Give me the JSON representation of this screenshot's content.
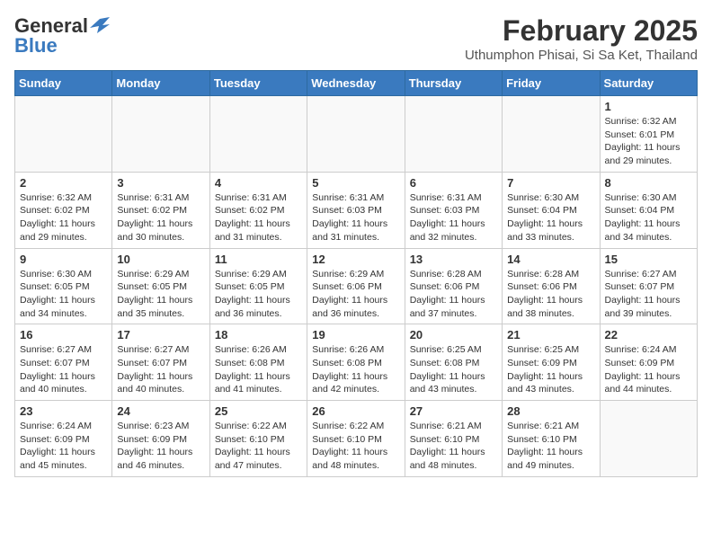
{
  "header": {
    "logo_general": "General",
    "logo_blue": "Blue",
    "month_year": "February 2025",
    "location": "Uthumphon Phisai, Si Sa Ket, Thailand"
  },
  "days_of_week": [
    "Sunday",
    "Monday",
    "Tuesday",
    "Wednesday",
    "Thursday",
    "Friday",
    "Saturday"
  ],
  "weeks": [
    [
      {
        "day": "",
        "info": ""
      },
      {
        "day": "",
        "info": ""
      },
      {
        "day": "",
        "info": ""
      },
      {
        "day": "",
        "info": ""
      },
      {
        "day": "",
        "info": ""
      },
      {
        "day": "",
        "info": ""
      },
      {
        "day": "1",
        "info": "Sunrise: 6:32 AM\nSunset: 6:01 PM\nDaylight: 11 hours and 29 minutes."
      }
    ],
    [
      {
        "day": "2",
        "info": "Sunrise: 6:32 AM\nSunset: 6:02 PM\nDaylight: 11 hours and 29 minutes."
      },
      {
        "day": "3",
        "info": "Sunrise: 6:31 AM\nSunset: 6:02 PM\nDaylight: 11 hours and 30 minutes."
      },
      {
        "day": "4",
        "info": "Sunrise: 6:31 AM\nSunset: 6:02 PM\nDaylight: 11 hours and 31 minutes."
      },
      {
        "day": "5",
        "info": "Sunrise: 6:31 AM\nSunset: 6:03 PM\nDaylight: 11 hours and 31 minutes."
      },
      {
        "day": "6",
        "info": "Sunrise: 6:31 AM\nSunset: 6:03 PM\nDaylight: 11 hours and 32 minutes."
      },
      {
        "day": "7",
        "info": "Sunrise: 6:30 AM\nSunset: 6:04 PM\nDaylight: 11 hours and 33 minutes."
      },
      {
        "day": "8",
        "info": "Sunrise: 6:30 AM\nSunset: 6:04 PM\nDaylight: 11 hours and 34 minutes."
      }
    ],
    [
      {
        "day": "9",
        "info": "Sunrise: 6:30 AM\nSunset: 6:05 PM\nDaylight: 11 hours and 34 minutes."
      },
      {
        "day": "10",
        "info": "Sunrise: 6:29 AM\nSunset: 6:05 PM\nDaylight: 11 hours and 35 minutes."
      },
      {
        "day": "11",
        "info": "Sunrise: 6:29 AM\nSunset: 6:05 PM\nDaylight: 11 hours and 36 minutes."
      },
      {
        "day": "12",
        "info": "Sunrise: 6:29 AM\nSunset: 6:06 PM\nDaylight: 11 hours and 36 minutes."
      },
      {
        "day": "13",
        "info": "Sunrise: 6:28 AM\nSunset: 6:06 PM\nDaylight: 11 hours and 37 minutes."
      },
      {
        "day": "14",
        "info": "Sunrise: 6:28 AM\nSunset: 6:06 PM\nDaylight: 11 hours and 38 minutes."
      },
      {
        "day": "15",
        "info": "Sunrise: 6:27 AM\nSunset: 6:07 PM\nDaylight: 11 hours and 39 minutes."
      }
    ],
    [
      {
        "day": "16",
        "info": "Sunrise: 6:27 AM\nSunset: 6:07 PM\nDaylight: 11 hours and 40 minutes."
      },
      {
        "day": "17",
        "info": "Sunrise: 6:27 AM\nSunset: 6:07 PM\nDaylight: 11 hours and 40 minutes."
      },
      {
        "day": "18",
        "info": "Sunrise: 6:26 AM\nSunset: 6:08 PM\nDaylight: 11 hours and 41 minutes."
      },
      {
        "day": "19",
        "info": "Sunrise: 6:26 AM\nSunset: 6:08 PM\nDaylight: 11 hours and 42 minutes."
      },
      {
        "day": "20",
        "info": "Sunrise: 6:25 AM\nSunset: 6:08 PM\nDaylight: 11 hours and 43 minutes."
      },
      {
        "day": "21",
        "info": "Sunrise: 6:25 AM\nSunset: 6:09 PM\nDaylight: 11 hours and 43 minutes."
      },
      {
        "day": "22",
        "info": "Sunrise: 6:24 AM\nSunset: 6:09 PM\nDaylight: 11 hours and 44 minutes."
      }
    ],
    [
      {
        "day": "23",
        "info": "Sunrise: 6:24 AM\nSunset: 6:09 PM\nDaylight: 11 hours and 45 minutes."
      },
      {
        "day": "24",
        "info": "Sunrise: 6:23 AM\nSunset: 6:09 PM\nDaylight: 11 hours and 46 minutes."
      },
      {
        "day": "25",
        "info": "Sunrise: 6:22 AM\nSunset: 6:10 PM\nDaylight: 11 hours and 47 minutes."
      },
      {
        "day": "26",
        "info": "Sunrise: 6:22 AM\nSunset: 6:10 PM\nDaylight: 11 hours and 48 minutes."
      },
      {
        "day": "27",
        "info": "Sunrise: 6:21 AM\nSunset: 6:10 PM\nDaylight: 11 hours and 48 minutes."
      },
      {
        "day": "28",
        "info": "Sunrise: 6:21 AM\nSunset: 6:10 PM\nDaylight: 11 hours and 49 minutes."
      },
      {
        "day": "",
        "info": ""
      }
    ]
  ]
}
